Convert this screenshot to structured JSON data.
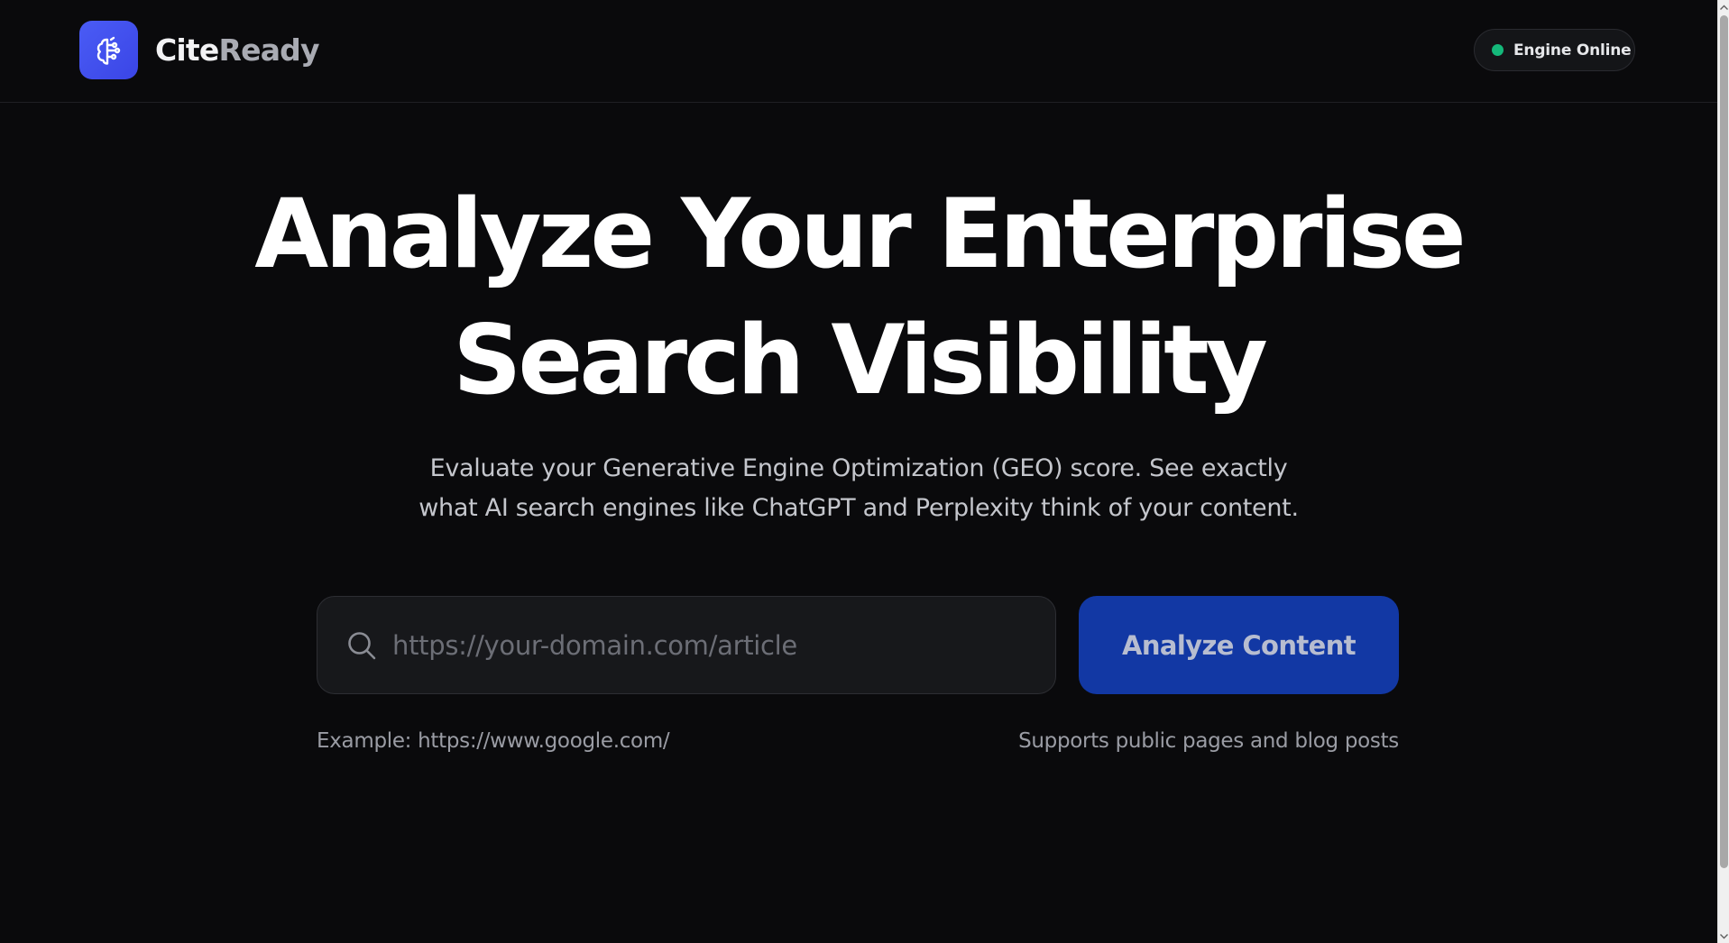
{
  "header": {
    "brand_main": "Cite",
    "brand_accent": "Ready",
    "logo_icon": "brain-circuit-icon",
    "status": {
      "text": "Engine Online",
      "color": "#14b87a"
    }
  },
  "hero": {
    "title_line1": "Analyze Your Enterprise",
    "title_line2": "Search Visibility",
    "subtitle_line1": "Evaluate your Generative Engine Optimization (GEO) score. See exactly",
    "subtitle_line2": "what AI search engines like ChatGPT and Perplexity think of your content."
  },
  "search": {
    "placeholder": "https://your-domain.com/article",
    "value": "",
    "icon": "search-icon",
    "button_label": "Analyze Content",
    "example_hint": "Example: https://www.google.com/",
    "support_hint": "Supports public pages and blog posts"
  },
  "colors": {
    "background": "#0a0a0c",
    "logo_accent": "#4a5cf5",
    "button": "#1238a4"
  }
}
